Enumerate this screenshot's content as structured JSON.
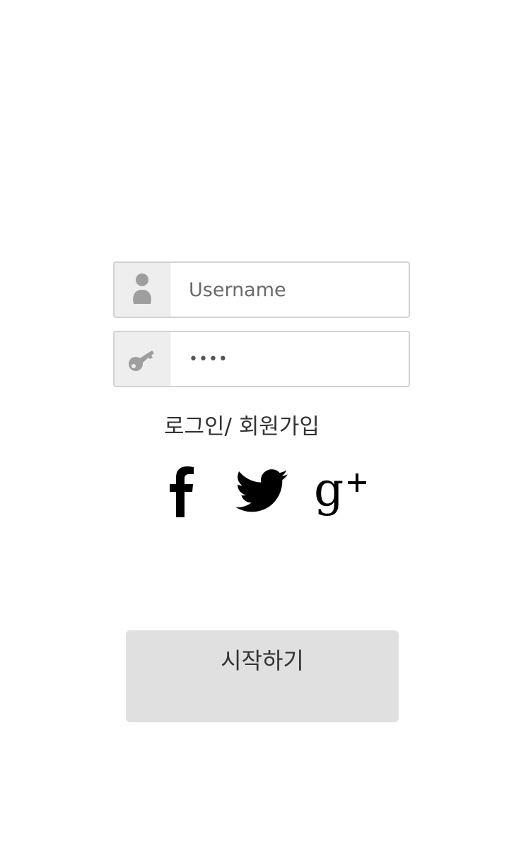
{
  "login_form": {
    "username": {
      "icon": "user-icon",
      "value": "",
      "placeholder": "Username"
    },
    "password": {
      "icon": "key-icon",
      "value": "••••",
      "placeholder": ""
    },
    "login_link_label": "로그인/ 회원가입"
  },
  "social_login": [
    {
      "icon": "facebook-icon"
    },
    {
      "icon": "twitter-icon"
    },
    {
      "icon": "google-plus-icon"
    }
  ],
  "start_button": {
    "label": "시작하기"
  },
  "colors": {
    "background": "#ffffff",
    "field_border": "#d2d2d2",
    "icon_box": "#eeeeee",
    "icon": "#9e9e9e",
    "button_bg": "#e0e0e0",
    "text": "#333333"
  }
}
